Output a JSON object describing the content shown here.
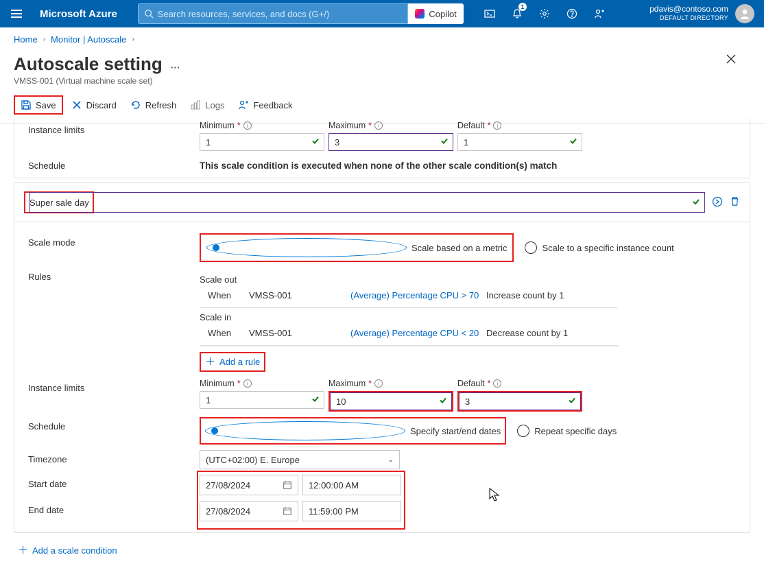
{
  "header": {
    "brand": "Microsoft Azure",
    "search_placeholder": "Search resources, services, and docs (G+/)",
    "copilot_label": "Copilot",
    "notification_count": "1",
    "account_email": "pdavis@contoso.com",
    "account_directory": "DEFAULT DIRECTORY"
  },
  "breadcrumbs": {
    "home": "Home",
    "monitor": "Monitor | Autoscale"
  },
  "blade": {
    "title": "Autoscale setting",
    "subtitle": "VMSS-001 (Virtual machine scale set)"
  },
  "toolbar": {
    "save": "Save",
    "discard": "Discard",
    "refresh": "Refresh",
    "logs": "Logs",
    "feedback": "Feedback"
  },
  "default_condition": {
    "instance_limits_label": "Instance limits",
    "min_label": "Minimum",
    "max_label": "Maximum",
    "def_label": "Default",
    "min_val": "1",
    "max_val": "3",
    "def_val": "1",
    "schedule_label": "Schedule",
    "schedule_text": "This scale condition is executed when none of the other scale condition(s) match"
  },
  "cond2": {
    "name": "Super sale day",
    "scale_mode_label": "Scale mode",
    "mode_metric": "Scale based on a metric",
    "mode_count": "Scale to a specific instance count",
    "rules_label": "Rules",
    "scale_out_label": "Scale out",
    "scale_in_label": "Scale in",
    "when": "When",
    "resource": "VMSS-001",
    "out_cond": "(Average) Percentage CPU > 70",
    "out_act": "Increase count by 1",
    "in_cond": "(Average) Percentage CPU < 20",
    "in_act": "Decrease count by 1",
    "add_rule": "Add a rule",
    "instance_limits_label": "Instance limits",
    "min_label": "Minimum",
    "max_label": "Maximum",
    "def_label": "Default",
    "min_val": "1",
    "max_val": "10",
    "def_val": "3",
    "schedule_label": "Schedule",
    "sched_dates": "Specify start/end dates",
    "sched_repeat": "Repeat specific days",
    "timezone_label": "Timezone",
    "timezone_val": "(UTC+02:00) E. Europe",
    "start_label": "Start date",
    "end_label": "End date",
    "start_date": "27/08/2024",
    "start_time": "12:00:00 AM",
    "end_date": "27/08/2024",
    "end_time": "11:59:00 PM"
  },
  "footer": {
    "add_condition": "Add a scale condition"
  }
}
